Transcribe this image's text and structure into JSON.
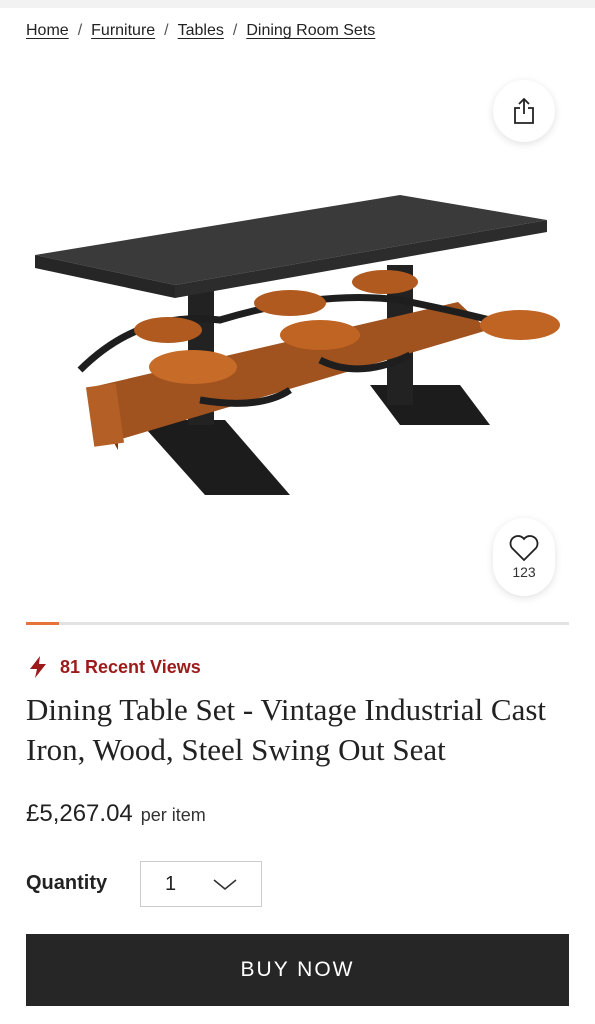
{
  "breadcrumb": {
    "items": [
      "Home",
      "Furniture",
      "Tables",
      "Dining Room Sets"
    ],
    "separator": "/"
  },
  "share": {
    "icon": "share-icon"
  },
  "favorite": {
    "icon": "heart-icon",
    "count": "123"
  },
  "gallery": {
    "progress_fraction": 0.06,
    "progress_color": "#e8733a"
  },
  "recent_views": {
    "icon": "lightning-icon",
    "text": "81 Recent Views",
    "color": "#9b1b1b"
  },
  "product": {
    "title": "Dining Table Set - Vintage Industrial Cast Iron, Wood, Steel Swing Out Seat",
    "price": "£5,267.04",
    "price_unit": "per item"
  },
  "quantity": {
    "label": "Quantity",
    "value": "1",
    "icon": "chevron-down-icon"
  },
  "buy_button": {
    "label": "BUY NOW",
    "color": "#262626"
  }
}
